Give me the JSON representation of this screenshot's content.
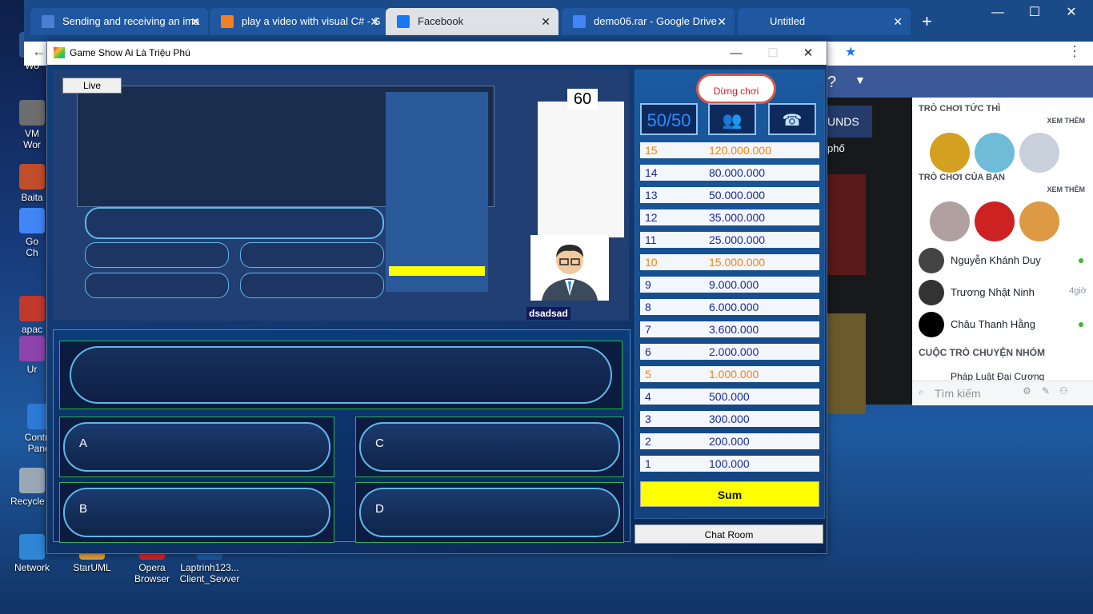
{
  "desktop": {
    "icons": [
      {
        "label": "Wo",
        "name": "desktop-icon-word-1"
      },
      {
        "label": "VM\nWor",
        "name": "desktop-icon-vmware"
      },
      {
        "label": "Baita",
        "name": "desktop-icon-baita"
      },
      {
        "label": "Go\nCh",
        "name": "desktop-icon-google-chrome"
      },
      {
        "label": "apac",
        "name": "desktop-icon-apache"
      },
      {
        "label": "Ur",
        "name": "desktop-icon-ur"
      },
      {
        "label": "Control\nPanel",
        "name": "desktop-icon-control-panel"
      },
      {
        "label": "Recycle B",
        "name": "desktop-icon-recycle-bin"
      },
      {
        "label": "Network",
        "name": "desktop-icon-network"
      },
      {
        "label": "StarUML",
        "name": "desktop-icon-staruml"
      },
      {
        "label": "Opera\nBrowser",
        "name": "desktop-icon-opera"
      },
      {
        "label": "Laptrinh123...\nClient_Sevver",
        "name": "desktop-icon-laptrinh-client"
      }
    ]
  },
  "browser": {
    "tabs": [
      {
        "title": "Sending and receiving an ima",
        "icon_color": "#4a7fd4"
      },
      {
        "title": "play a video with visual C# - S",
        "icon_color": "#f48024"
      },
      {
        "title": "Facebook",
        "icon_color": "#1877f2"
      },
      {
        "title": "demo06.rar - Google Drive",
        "icon_color": "#4285f4"
      },
      {
        "title": "Untitled",
        "icon_color": "#1a4a88"
      }
    ],
    "new_tab": "+",
    "window_controls": {
      "minimize": "—",
      "maximize": "☐",
      "close": "✕"
    }
  },
  "facebook": {
    "instant_games_title": "TRÒ CHƠI TỨC THÌ",
    "see_more": "XEM THÊM",
    "your_games_title": "TRÒ CHƠI CỦA BẠN",
    "side_texts": [
      "UNDS",
      "phố"
    ],
    "contacts": [
      {
        "name": "Nguyễn Khánh Duy",
        "status": "online"
      },
      {
        "name": "Trương Nhật Ninh",
        "status": "4giờ"
      },
      {
        "name": "Châu Thanh Hằng",
        "status": "online"
      }
    ],
    "group_chats_title": "CUỘC TRÒ CHUYỆN NHÓM",
    "group_first": "Pháp Luật Đại Cương",
    "search_placeholder": "Tìm kiếm"
  },
  "game": {
    "window_title": "Game Show Ai Là Triệu Phú",
    "window_controls": {
      "minimize": "—",
      "maximize": "☐",
      "close": "✕"
    },
    "live_label": "Live",
    "timer": "60",
    "player_name": "dsadsad",
    "stop_label": "Dừng chơi",
    "lifelines": {
      "fifty": "50/50",
      "audience": "👥",
      "phone": "☎"
    },
    "answers": {
      "a": "A",
      "b": "B",
      "c": "C",
      "d": "D"
    },
    "prizes": [
      {
        "level": "15",
        "amount": "120.000.000",
        "milestone": true
      },
      {
        "level": "14",
        "amount": "80.000.000",
        "milestone": false
      },
      {
        "level": "13",
        "amount": "50.000.000",
        "milestone": false
      },
      {
        "level": "12",
        "amount": "35.000.000",
        "milestone": false
      },
      {
        "level": "11",
        "amount": "25.000.000",
        "milestone": false
      },
      {
        "level": "10",
        "amount": "15.000.000",
        "milestone": true
      },
      {
        "level": "9",
        "amount": "9.000.000",
        "milestone": false
      },
      {
        "level": "8",
        "amount": "6.000.000",
        "milestone": false
      },
      {
        "level": "7",
        "amount": "3.600.000",
        "milestone": false
      },
      {
        "level": "6",
        "amount": "2.000.000",
        "milestone": false
      },
      {
        "level": "5",
        "amount": "1.000.000",
        "milestone": true
      },
      {
        "level": "4",
        "amount": "500.000",
        "milestone": false
      },
      {
        "level": "3",
        "amount": "300.000",
        "milestone": false
      },
      {
        "level": "2",
        "amount": "200.000",
        "milestone": false
      },
      {
        "level": "1",
        "amount": "100.000",
        "milestone": false
      }
    ],
    "sum_label": "Sum",
    "chat_room_label": "Chat Room"
  }
}
